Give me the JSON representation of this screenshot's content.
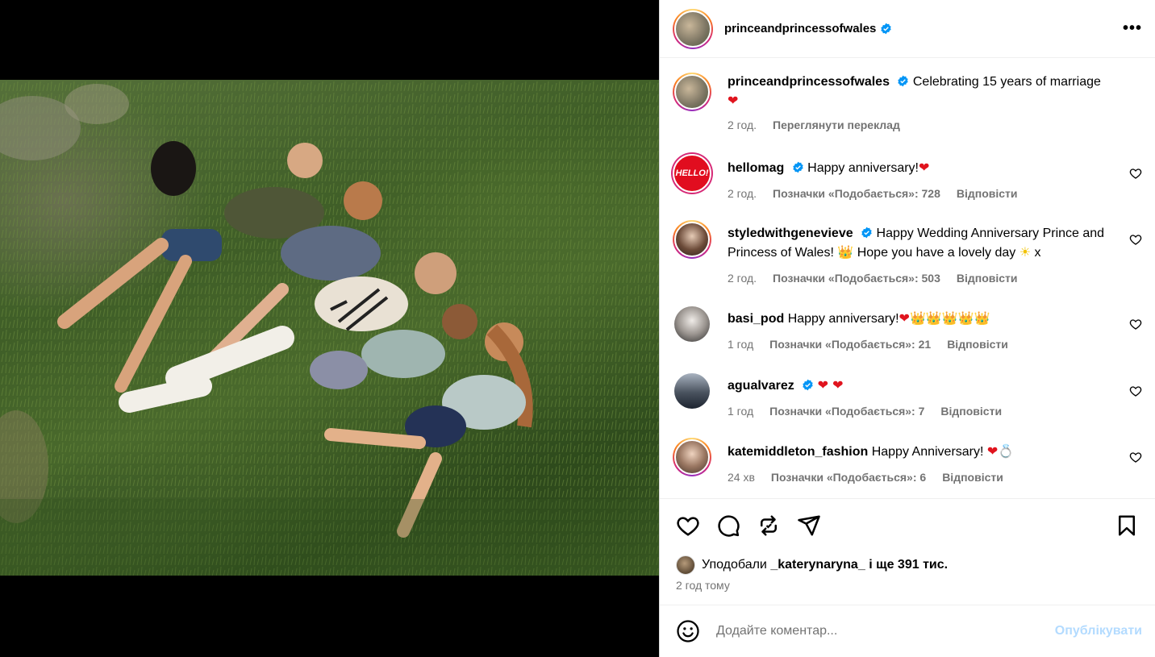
{
  "post": {
    "author": "princeandprincessofwales",
    "caption": "Celebrating 15 years of marriage",
    "caption_emoji": "❤",
    "time": "2 год.",
    "translate_label": "Переглянути переклад"
  },
  "comments": [
    {
      "username": "hellomag",
      "verified": true,
      "text": "Happy anniversary!",
      "emoji": "❤",
      "time": "2 год.",
      "likes_label": "Позначки «Подобається»: 728",
      "reply_label": "Відповісти",
      "avatar_text": "HELLO!"
    },
    {
      "username": "styledwithgenevieve",
      "verified": true,
      "text": "Happy Wedding Anniversary Prince and Princess of Wales!",
      "emoji_1": "👑",
      "text_2": "Hope you have a lovely day",
      "emoji_2": "☀",
      "text_3": "x",
      "time": "2 год.",
      "likes_label": "Позначки «Подобається»: 503",
      "reply_label": "Відповісти"
    },
    {
      "username": "basi_pod",
      "verified": false,
      "text": "Happy anniversary!",
      "emoji": "❤👑👑👑👑👑",
      "time": "1 год",
      "likes_label": "Позначки «Подобається»: 21",
      "reply_label": "Відповісти"
    },
    {
      "username": "agualvarez",
      "verified": true,
      "text": "",
      "emoji": "❤ ❤",
      "time": "1 год",
      "likes_label": "Позначки «Подобається»: 7",
      "reply_label": "Відповісти"
    },
    {
      "username": "katemiddleton_fashion",
      "verified": false,
      "text": "Happy Anniversary!",
      "emoji": "❤💍",
      "time": "24 хв",
      "likes_label": "Позначки «Подобається»: 6",
      "reply_label": "Відповісти"
    }
  ],
  "likes": {
    "prefix": "Уподобали",
    "user": "_katerynaryna_",
    "suffix": "і ще 391 тис."
  },
  "time_ago": "2 год тому",
  "composer": {
    "placeholder": "Додайте коментар...",
    "post_label": "Опублікувати"
  },
  "colors": {
    "verified": "#0095f6",
    "link_disabled": "#b3dbff",
    "secondary_text": "#737373"
  }
}
